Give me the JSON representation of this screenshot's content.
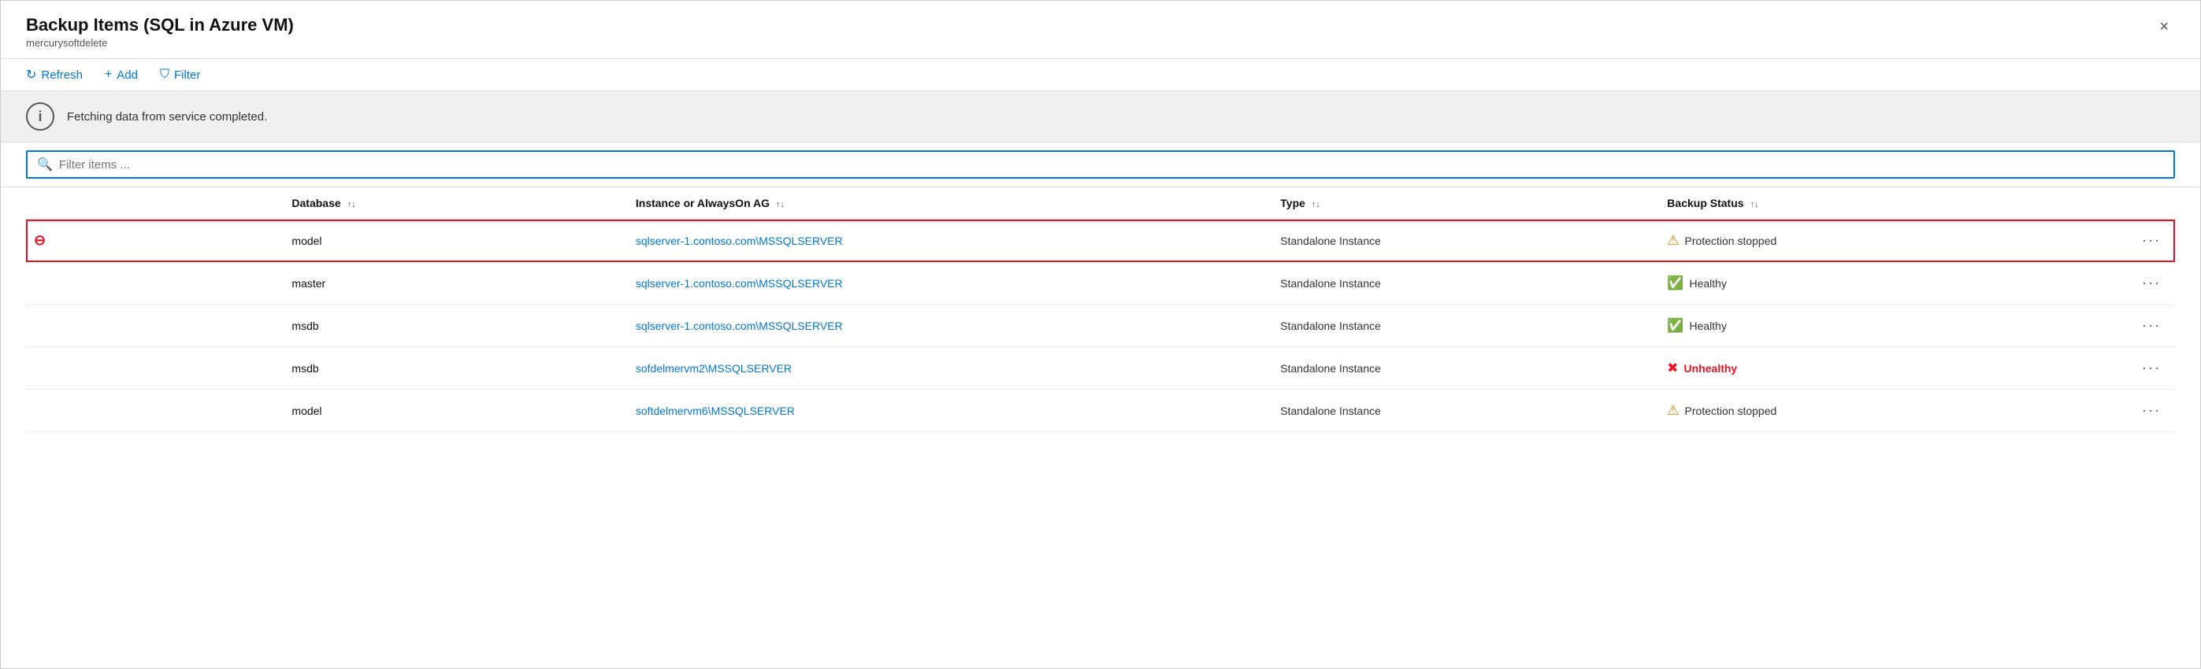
{
  "header": {
    "title": "Backup Items (SQL in Azure VM)",
    "subtitle": "mercurysoftdelete",
    "close_label": "×"
  },
  "toolbar": {
    "refresh_label": "Refresh",
    "add_label": "Add",
    "filter_label": "Filter"
  },
  "info_bar": {
    "message": "Fetching data from service completed."
  },
  "search": {
    "placeholder": "Filter items ..."
  },
  "table": {
    "columns": [
      {
        "id": "icon",
        "label": ""
      },
      {
        "id": "database",
        "label": "Database"
      },
      {
        "id": "instance",
        "label": "Instance or AlwaysOn AG"
      },
      {
        "id": "type",
        "label": "Type"
      },
      {
        "id": "status",
        "label": "Backup Status"
      },
      {
        "id": "more",
        "label": ""
      }
    ],
    "rows": [
      {
        "highlighted": true,
        "row_icon": "stop",
        "database": "model",
        "instance": "sqlserver-1.contoso.com\\MSSQLSERVER",
        "type": "Standalone Instance",
        "status": "Protection stopped",
        "status_type": "warning"
      },
      {
        "highlighted": false,
        "row_icon": "none",
        "database": "master",
        "instance": "sqlserver-1.contoso.com\\MSSQLSERVER",
        "type": "Standalone Instance",
        "status": "Healthy",
        "status_type": "healthy"
      },
      {
        "highlighted": false,
        "row_icon": "none",
        "database": "msdb",
        "instance": "sqlserver-1.contoso.com\\MSSQLSERVER",
        "type": "Standalone Instance",
        "status": "Healthy",
        "status_type": "healthy"
      },
      {
        "highlighted": false,
        "row_icon": "none",
        "database": "msdb",
        "instance": "sofdelmervm2\\MSSQLSERVER",
        "type": "Standalone Instance",
        "status": "Unhealthy",
        "status_type": "error"
      },
      {
        "highlighted": false,
        "row_icon": "none",
        "database": "model",
        "instance": "softdelmervm6\\MSSQLSERVER",
        "type": "Standalone Instance",
        "status": "Protection stopped",
        "status_type": "warning"
      }
    ]
  },
  "colors": {
    "accent": "#0078d4",
    "warning": "#d47e00",
    "healthy": "#107c10",
    "error": "#e81123"
  }
}
